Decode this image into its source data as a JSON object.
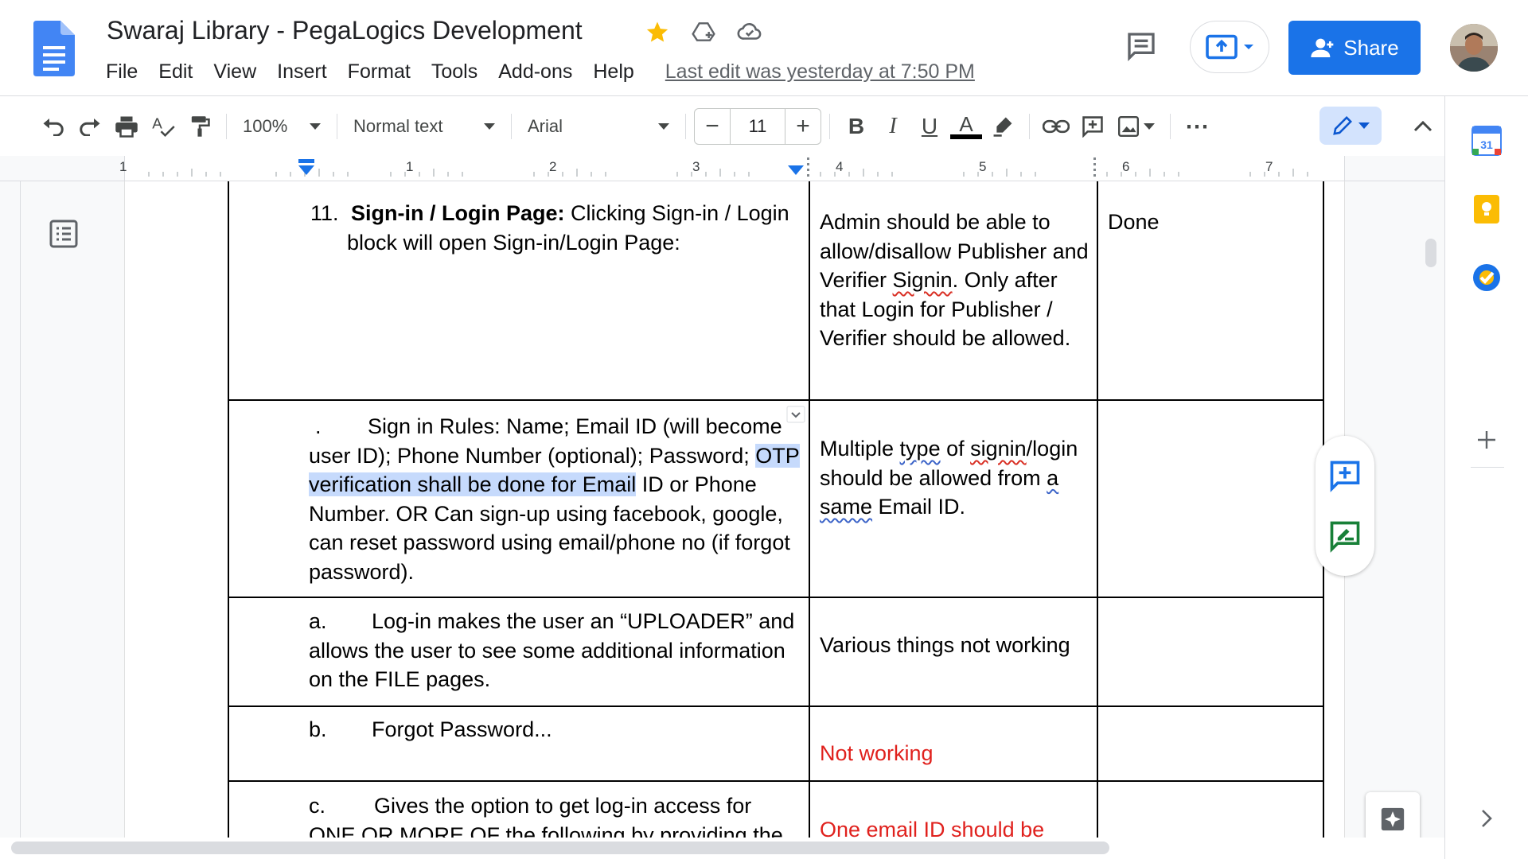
{
  "document": {
    "title": "Swaraj Library - PegaLogics Development",
    "last_edit": "Last edit was yesterday at 7:50 PM"
  },
  "menu": [
    "File",
    "Edit",
    "View",
    "Insert",
    "Format",
    "Tools",
    "Add-ons",
    "Help"
  ],
  "header": {
    "share_label": "Share",
    "icons": {
      "star": "star-icon",
      "move": "move-to-drive-icon",
      "cloud": "cloud-saved-icon",
      "comments": "comment-history-icon",
      "present": "present-icon"
    },
    "colors": {
      "share_bg": "#1a73e8",
      "star": "#fbbc04"
    }
  },
  "toolbar": {
    "zoom": "100%",
    "style": "Normal text",
    "font": "Arial",
    "font_size": "11",
    "minus": "−",
    "plus": "+",
    "bold": "B",
    "italic": "I",
    "underline": "U",
    "text_color": "A",
    "more": "⋯"
  },
  "ruler": {
    "labels": [
      "1",
      "1",
      "2",
      "3",
      "4",
      "5",
      "6",
      "7"
    ]
  },
  "table": {
    "rows": [
      {
        "c1_num": "11.",
        "c1_bold": "Sign-in / Login Page:",
        "c1_text": " Clicking Sign-in / Login block will open Sign-in/Login Page:",
        "c2_pre": "Admin should be able to allow/disallow Publisher and Verifier ",
        "c2_sq": "Signin",
        "c2_post": ". Only after that Login for Publisher / Verifier should be allowed.",
        "c3": "Done"
      },
      {
        "c1_marker": ".",
        "c1_text_a": "Sign in Rules: Name; Email ID (will become user ID); Phone Number (optional); Password; ",
        "c1_highlight": "OTP verification shall be done for Email",
        "c1_text_b": " ID or Phone Number. OR Can sign-up using facebook, google, can reset password using email/phone no (if forgot password).",
        "c2_a": "Multiple ",
        "c2_b": "type",
        "c2_c": " of ",
        "c2_d": "signin",
        "c2_e": "/login should be allowed from ",
        "c2_f": "a",
        "c2_g": "same",
        "c2_h": " Email ID.",
        "c3": ""
      },
      {
        "c1_marker": "a.",
        "c1_text": "Log-in makes the user an “UPLOADER” and allows the user to see some additional information on the FILE pages.",
        "c2": "Various things not working",
        "c3": ""
      },
      {
        "c1_marker": "b.",
        "c1_text": "Forgot Password...",
        "c2": "Not working",
        "c3": ""
      },
      {
        "c1_marker": "c.",
        "c1_text": "Gives the option to get log-in access for ONE OR MORE OF the following by providing the",
        "c2": "One email ID should be",
        "c3": ""
      }
    ],
    "colors": {
      "highlight": "#c6dafc",
      "red_text": "#e0211d"
    }
  },
  "side_panel": {
    "calendar_day": "31",
    "icons": [
      "calendar-icon",
      "keep-icon",
      "tasks-icon",
      "add-addon-icon"
    ]
  }
}
